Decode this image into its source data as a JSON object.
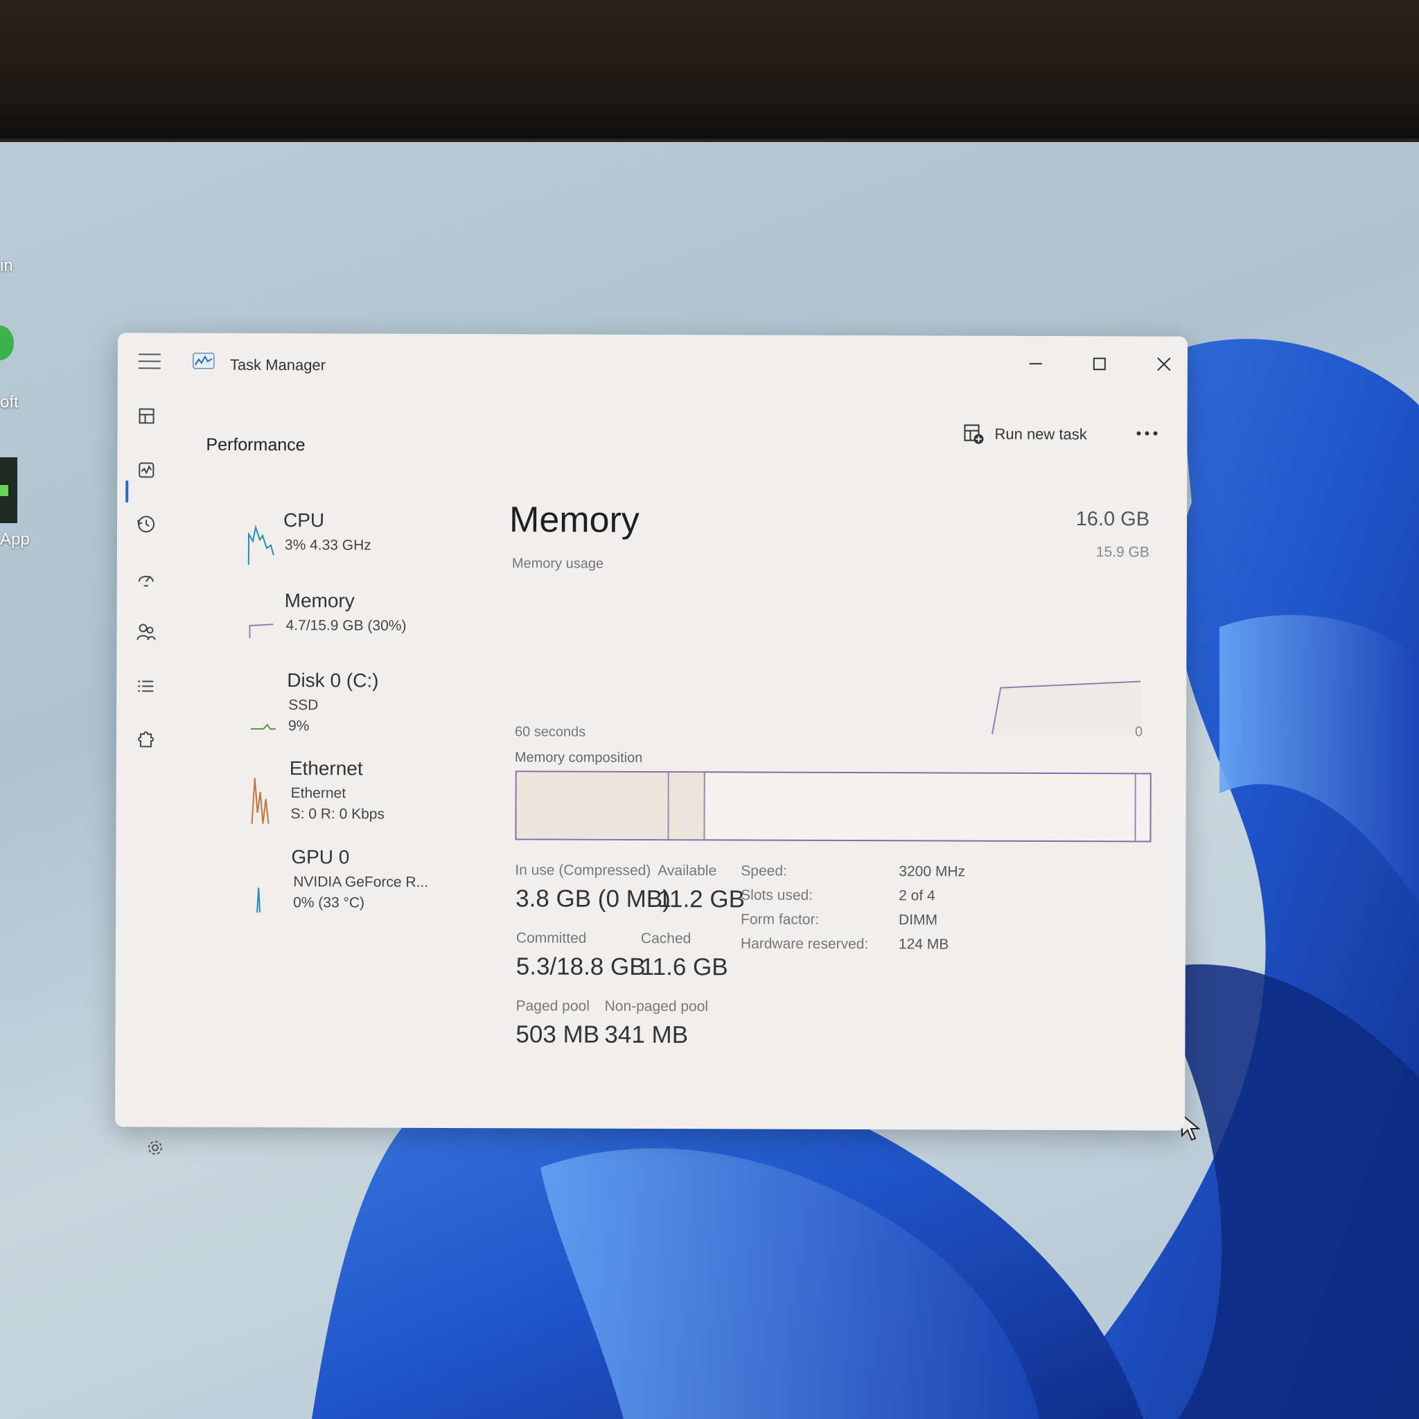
{
  "desktop": {
    "labels": [
      "in",
      "oft",
      "App"
    ]
  },
  "window": {
    "title": "Task Manager",
    "page_title": "Performance",
    "run_new_task": "Run new task"
  },
  "devices": [
    {
      "name": "CPU",
      "sub1": "3% 4.33 GHz",
      "sub2": ""
    },
    {
      "name": "Memory",
      "sub1": "4.7/15.9 GB (30%)",
      "sub2": ""
    },
    {
      "name": "Disk 0 (C:)",
      "sub1": "SSD",
      "sub2": "9%"
    },
    {
      "name": "Ethernet",
      "sub1": "Ethernet",
      "sub2": "S: 0 R: 0 Kbps"
    },
    {
      "name": "GPU 0",
      "sub1": "NVIDIA GeForce R...",
      "sub2": "0% (33 °C)"
    }
  ],
  "memory": {
    "title": "Memory",
    "usage_label": "Memory usage",
    "total": "16.0 GB",
    "total_sub": "15.9 GB",
    "time_label": "60 seconds",
    "zero_label": "0",
    "composition_label": "Memory composition",
    "usage_fraction": 0.3,
    "stats": {
      "in_use_label": "In use (Compressed)",
      "in_use_value": "3.8 GB (0 MB)",
      "available_label": "Available",
      "available_value": "11.2 GB",
      "committed_label": "Committed",
      "committed_value": "5.3/18.8 GB",
      "cached_label": "Cached",
      "cached_value": "11.6 GB",
      "paged_label": "Paged pool",
      "paged_value": "503 MB",
      "nonpaged_label": "Non-paged pool",
      "nonpaged_value": "341 MB"
    },
    "specs": [
      {
        "key": "Speed:",
        "value": "3200 MHz"
      },
      {
        "key": "Slots used:",
        "value": "2 of 4"
      },
      {
        "key": "Form factor:",
        "value": "DIMM"
      },
      {
        "key": "Hardware reserved:",
        "value": "124 MB"
      }
    ]
  },
  "colors": {
    "accent": "#2b68c4",
    "memory_line": "#9a7ab2",
    "cpu_line": "#2a8bb0",
    "ethernet_line": "#c7743a",
    "disk_line": "#5a9a3a"
  }
}
